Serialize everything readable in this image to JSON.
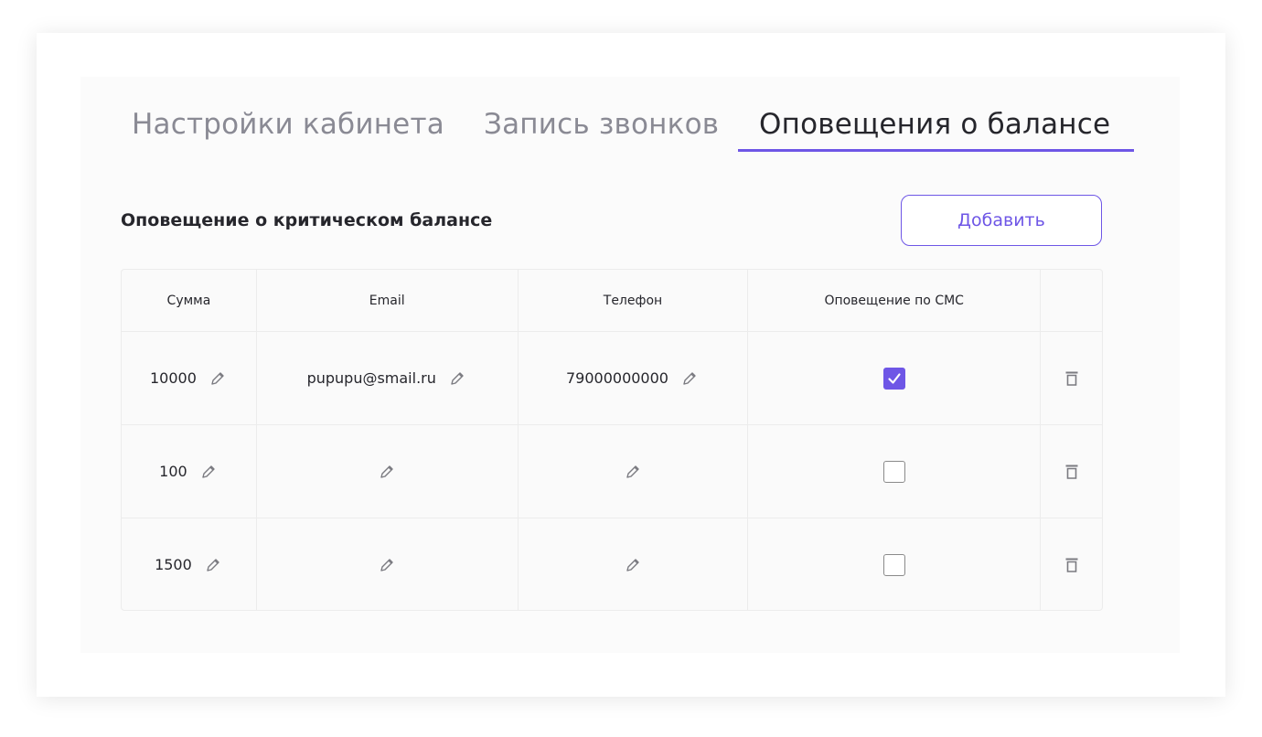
{
  "tabs": [
    {
      "label": "Настройки кабинета",
      "active": false
    },
    {
      "label": "Запись звонков",
      "active": false
    },
    {
      "label": "Оповещения о балансе",
      "active": true
    }
  ],
  "section": {
    "title": "Оповещение о критическом балансе",
    "add_button": "Добавить"
  },
  "table": {
    "columns": [
      "Сумма",
      "Email",
      "Телефон",
      "Оповещение по СМС",
      ""
    ],
    "rows": [
      {
        "amount": "10000",
        "email": "pupupu@smail.ru",
        "phone": "79000000000",
        "sms": true
      },
      {
        "amount": "100",
        "email": "",
        "phone": "",
        "sms": false
      },
      {
        "amount": "1500",
        "email": "",
        "phone": "",
        "sms": false
      }
    ]
  },
  "icons": {
    "edit": "pencil-icon",
    "delete": "trash-icon",
    "check": "checkmark-icon"
  },
  "colors": {
    "accent": "#6e56e6",
    "text": "#26262c",
    "muted": "#8a8a94",
    "border": "#ececec"
  }
}
